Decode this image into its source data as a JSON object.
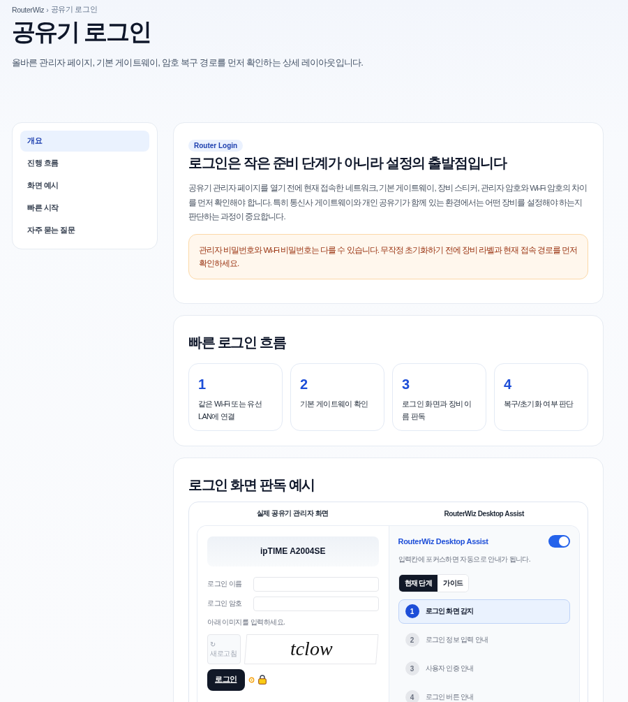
{
  "breadcrumb": {
    "link": "RouterWiz",
    "separator": "›",
    "current": "공유기 로그인"
  },
  "header": {
    "title": "공유기 로그인",
    "subtitle": "올바른 관리자 페이지, 기본 게이트웨이, 암호 복구 경로를 먼저 확인하는 상세 레이아웃입니다."
  },
  "sidebar": {
    "items": [
      {
        "label": "개요",
        "selected": true
      },
      {
        "label": "진행 흐름",
        "selected": false
      },
      {
        "label": "화면 예시",
        "selected": false
      },
      {
        "label": "빠른 시작",
        "selected": false
      },
      {
        "label": "자주 묻는 질문",
        "selected": false
      }
    ]
  },
  "overview": {
    "badge": "Router Login",
    "heading": "로그인은 작은 준비 단계가 아니라 설정의 출발점입니다",
    "paragraph": "공유기 관리자 페이지를 열기 전에 현재 접속한 네트워크, 기본 게이트웨이, 장비 스티커, 관리자 암호와 Wi-Fi 암호의 차이를 먼저 확인해야 합니다. 특히 통신사 게이트웨이와 개인 공유기가 함께 있는 환경에서는 어떤 장비를 설정해야 하는지 판단하는 과정이 중요합니다.",
    "alert": "관리자 비밀번호와 Wi-Fi 비밀번호는 다를 수 있습니다. 무작정 초기화하기 전에 장비 라벨과 현재 접속 경로를 먼저 확인하세요."
  },
  "flow": {
    "heading": "빠른 로그인 흐름",
    "steps": [
      {
        "number": "1",
        "text": "같은 Wi-Fi 또는 유선 LAN에 연결"
      },
      {
        "number": "2",
        "text": "기본 게이트웨이 확인"
      },
      {
        "number": "3",
        "text": "로그인 화면과 장비 이름 판독"
      },
      {
        "number": "4",
        "text": "복구/초기화 여부 판단"
      }
    ]
  },
  "example": {
    "heading": "로그인 화면 판독 예시",
    "columns": [
      "실제 공유기 관리자 화면",
      "RouterWiz Desktop Assist"
    ],
    "router": {
      "model": "ipTIME A2004SE",
      "fields": [
        {
          "label": "로그인 이름"
        },
        {
          "label": "로그인 암호"
        }
      ],
      "captcha_prompt": "아래 이미지를 입력하세요.",
      "refresh": {
        "icon": "↻",
        "label": "새로고침"
      },
      "captcha_text": "tclow",
      "login_button": "로그인"
    },
    "assist": {
      "title": "RouterWiz Desktop Assist",
      "enabled": true,
      "hint": "입력칸에 포커스하면 자동으로 안내가 됩니다.",
      "tabs": [
        {
          "label": "현재 단계",
          "selected": true
        },
        {
          "label": "가이드",
          "selected": false
        }
      ],
      "steps": [
        {
          "number": "1",
          "label": "로그인 화면 감지",
          "selected": true
        },
        {
          "number": "2",
          "label": "로그인 정보 입력 안내",
          "selected": false
        },
        {
          "number": "3",
          "label": "사용자 인증 안내",
          "selected": false
        },
        {
          "number": "4",
          "label": "로그인 버튼 안내",
          "selected": false
        }
      ]
    }
  }
}
